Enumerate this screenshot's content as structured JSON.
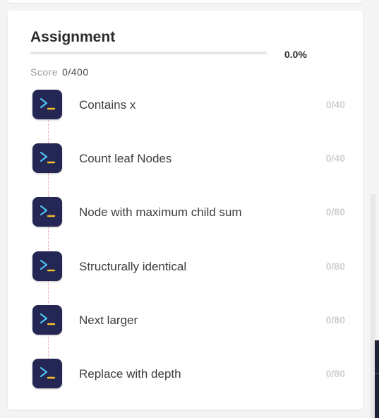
{
  "assignment": {
    "title": "Assignment",
    "progress_percent": "0.0%",
    "progress_fraction": 0.0,
    "score_label": "Score",
    "score_value": "0/400"
  },
  "colors": {
    "icon_bg": "#242654",
    "icon_prompt": "#4ec3f0",
    "icon_cursor": "#f5c02c",
    "timeline": "#f2a9c0"
  },
  "problems": [
    {
      "label": "Contains x",
      "score": "0/40",
      "icon": "terminal-icon"
    },
    {
      "label": "Count leaf Nodes",
      "score": "0/40",
      "icon": "terminal-icon"
    },
    {
      "label": "Node with maximum child sum",
      "score": "0/80",
      "icon": "terminal-icon"
    },
    {
      "label": "Structurally identical",
      "score": "0/80",
      "icon": "terminal-icon"
    },
    {
      "label": "Next larger",
      "score": "0/80",
      "icon": "terminal-icon"
    },
    {
      "label": "Replace with depth",
      "score": "0/80",
      "icon": "terminal-icon"
    }
  ]
}
